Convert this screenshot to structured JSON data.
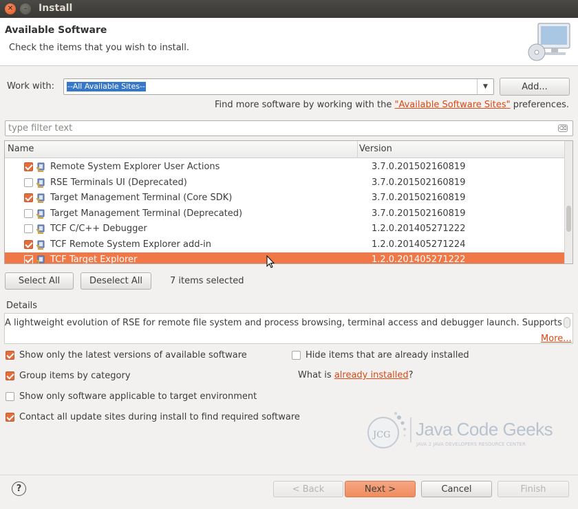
{
  "window": {
    "title": "Install"
  },
  "header": {
    "title": "Available Software",
    "subtitle": "Check the items that you wish to install."
  },
  "work_with": {
    "label": "Work with:",
    "value": "--All Available Sites--",
    "add_button": "Add...",
    "find_prefix": "Find more software by working with the ",
    "find_link": "\"Available Software Sites\"",
    "find_suffix": " preferences."
  },
  "filter": {
    "placeholder": "type filter text"
  },
  "table": {
    "columns": [
      "Name",
      "Version"
    ],
    "rows": [
      {
        "checked": true,
        "name": "Remote System Explorer User Actions",
        "version": "3.7.0.201502160819",
        "selected": false
      },
      {
        "checked": false,
        "name": "RSE Terminals UI (Deprecated)",
        "version": "3.7.0.201502160819",
        "selected": false
      },
      {
        "checked": true,
        "name": "Target Management Terminal (Core SDK)",
        "version": "3.7.0.201502160819",
        "selected": false
      },
      {
        "checked": false,
        "name": "Target Management Terminal (Deprecated)",
        "version": "3.7.0.201502160819",
        "selected": false
      },
      {
        "checked": false,
        "name": "TCF C/C++ Debugger",
        "version": "1.2.0.201405271222",
        "selected": false
      },
      {
        "checked": true,
        "name": "TCF Remote System Explorer add-in",
        "version": "1.2.0.201405271224",
        "selected": false
      },
      {
        "checked": true,
        "name": "TCF Target Explorer",
        "version": "1.2.0.201405271222",
        "selected": true
      }
    ]
  },
  "selection": {
    "select_all": "Select All",
    "deselect_all": "Deselect All",
    "count_text": "7 items selected"
  },
  "details": {
    "label": "Details",
    "text": "A lightweight evolution of RSE for remote file system and process browsing, terminal access and debugger launch. Supports",
    "more_link": "More..."
  },
  "options": {
    "latest_only": {
      "label": "Show only the latest versions of available software",
      "checked": true
    },
    "group_by_category": {
      "label": "Group items by category",
      "checked": true
    },
    "applicable_only": {
      "label": "Show only software applicable to target environment",
      "checked": false
    },
    "contact_sites": {
      "label": "Contact all update sites during install to find required software",
      "checked": true
    },
    "hide_installed": {
      "label": "Hide items that are already installed",
      "checked": false
    },
    "what_is_prefix": "What is ",
    "already_installed_link": "already installed",
    "what_is_suffix": "?"
  },
  "watermark": {
    "badge": "JCG",
    "name": "Java Code Geeks",
    "tagline": "JAVA 2 JAVA DEVELOPERS RESOURCE CENTER"
  },
  "footer": {
    "help_icon": "?",
    "back": "< Back",
    "next": "Next >",
    "cancel": "Cancel",
    "finish": "Finish"
  },
  "colors": {
    "accent": "#f07746",
    "link": "#dd4814"
  }
}
